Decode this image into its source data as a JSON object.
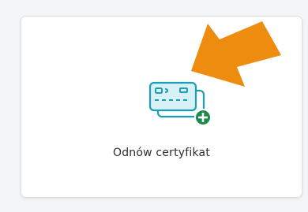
{
  "card": {
    "label": "Odnów certyfikat",
    "icon": "credit-card-add-icon"
  },
  "annotation": {
    "icon": "orange-arrow-icon",
    "color": "#ee8c0f"
  },
  "colors": {
    "icon_stroke": "#1b9eb5",
    "icon_fill": "#d8f1f6",
    "plus_badge": "#1e8a4a"
  }
}
